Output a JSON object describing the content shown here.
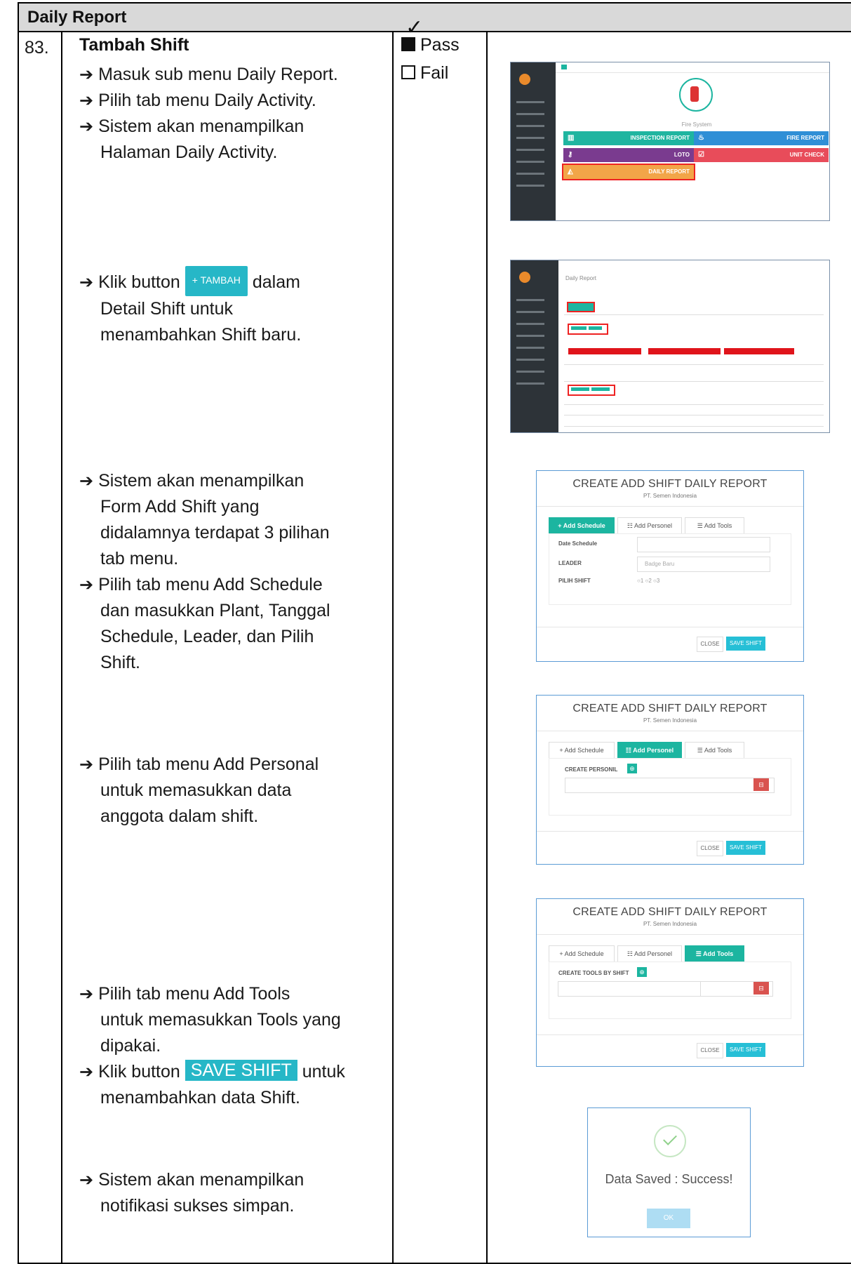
{
  "section_title": "Daily Report",
  "test_case": {
    "number": "83.",
    "title": "Tambah Shift",
    "result": {
      "pass_label": "Pass",
      "fail_label": "Fail",
      "pass_checked": true
    }
  },
  "steps": {
    "s1": "Masuk sub menu Daily Report.",
    "s2": "Pilih tab menu Daily Activity.",
    "s3_a": "Sistem akan menampilkan",
    "s3_b": "Halaman Daily Activity.",
    "s4_pre": "Klik button",
    "s4_btn": "TAMBAH",
    "s4_post": "dalam",
    "s4_b": "Detail Shift untuk",
    "s4_c": "menambahkan Shift baru.",
    "s5_a": "Sistem akan menampilkan",
    "s5_b": "Form Add Shift yang",
    "s5_c": "didalamnya terdapat 3 pilihan",
    "s5_d": "tab menu.",
    "s6_a": "Pilih tab menu Add Schedule",
    "s6_b": "dan masukkan Plant, Tanggal",
    "s6_c": "Schedule, Leader, dan Pilih",
    "s6_d": "Shift.",
    "s7_a": "Pilih tab menu Add Personal",
    "s7_b": "untuk memasukkan data",
    "s7_c": "anggota dalam shift.",
    "s8_a": "Pilih tab menu Add Tools",
    "s8_b": "untuk memasukkan Tools yang",
    "s8_c": "dipakai.",
    "s9_pre": "Klik button",
    "s9_btn": "SAVE SHIFT",
    "s9_post": "untuk",
    "s9_b": "menambahkan data Shift.",
    "s10_a": "Sistem akan menampilkan",
    "s10_b": "notifikasi sukses simpan."
  },
  "dashboard": {
    "section_label": "Fire System",
    "tiles": [
      {
        "label": "INSPECTION REPORT",
        "color": "#1fb5a0"
      },
      {
        "label": "FIRE REPORT",
        "color": "#2f8fd6"
      },
      {
        "label": "LOTO",
        "color": "#7a3b8f"
      },
      {
        "label": "UNIT CHECK",
        "color": "#e84c5a"
      },
      {
        "label": "DAILY REPORT",
        "color": "#f2a548"
      }
    ]
  },
  "daily_page": {
    "title": "Daily Report"
  },
  "modal": {
    "title": "CREATE ADD SHIFT DAILY REPORT",
    "subtitle": "PT. Semen Indonesia",
    "tabs": [
      "+ Add Schedule",
      "Add Personel",
      "Add Tools"
    ],
    "date_label": "Date Schedule",
    "leader_label": "LEADER",
    "leader_placeholder": "Badge Baru",
    "shift_label": "PILIH SHIFT",
    "shift_options": "○1 ○2 ○3",
    "personil_label": "CREATE PERSONIL",
    "tools_label": "CREATE TOOLS BY SHIFT",
    "close": "CLOSE",
    "save": "SAVE SHIFT"
  },
  "success": {
    "message": "Data Saved : Success!",
    "ok": "OK"
  },
  "colors": {
    "accent_teal": "#1cb5a0",
    "button_cyan": "#26bfd6",
    "danger": "#d9534f",
    "highlight_red": "#e0141b"
  }
}
